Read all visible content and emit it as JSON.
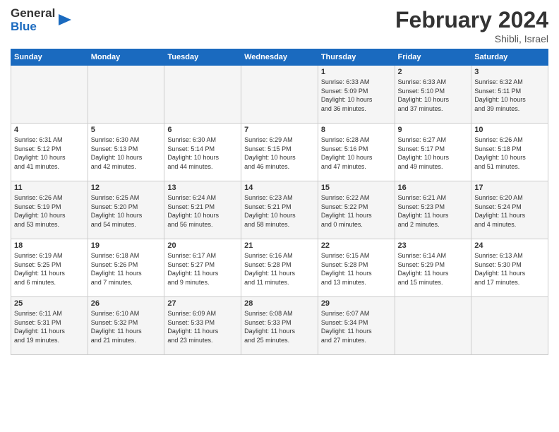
{
  "logo": {
    "general": "General",
    "blue": "Blue"
  },
  "title": "February 2024",
  "location": "Shibli, Israel",
  "weekdays": [
    "Sunday",
    "Monday",
    "Tuesday",
    "Wednesday",
    "Thursday",
    "Friday",
    "Saturday"
  ],
  "weeks": [
    [
      {
        "day": "",
        "info": ""
      },
      {
        "day": "",
        "info": ""
      },
      {
        "day": "",
        "info": ""
      },
      {
        "day": "",
        "info": ""
      },
      {
        "day": "1",
        "info": "Sunrise: 6:33 AM\nSunset: 5:09 PM\nDaylight: 10 hours\nand 36 minutes."
      },
      {
        "day": "2",
        "info": "Sunrise: 6:33 AM\nSunset: 5:10 PM\nDaylight: 10 hours\nand 37 minutes."
      },
      {
        "day": "3",
        "info": "Sunrise: 6:32 AM\nSunset: 5:11 PM\nDaylight: 10 hours\nand 39 minutes."
      }
    ],
    [
      {
        "day": "4",
        "info": "Sunrise: 6:31 AM\nSunset: 5:12 PM\nDaylight: 10 hours\nand 41 minutes."
      },
      {
        "day": "5",
        "info": "Sunrise: 6:30 AM\nSunset: 5:13 PM\nDaylight: 10 hours\nand 42 minutes."
      },
      {
        "day": "6",
        "info": "Sunrise: 6:30 AM\nSunset: 5:14 PM\nDaylight: 10 hours\nand 44 minutes."
      },
      {
        "day": "7",
        "info": "Sunrise: 6:29 AM\nSunset: 5:15 PM\nDaylight: 10 hours\nand 46 minutes."
      },
      {
        "day": "8",
        "info": "Sunrise: 6:28 AM\nSunset: 5:16 PM\nDaylight: 10 hours\nand 47 minutes."
      },
      {
        "day": "9",
        "info": "Sunrise: 6:27 AM\nSunset: 5:17 PM\nDaylight: 10 hours\nand 49 minutes."
      },
      {
        "day": "10",
        "info": "Sunrise: 6:26 AM\nSunset: 5:18 PM\nDaylight: 10 hours\nand 51 minutes."
      }
    ],
    [
      {
        "day": "11",
        "info": "Sunrise: 6:26 AM\nSunset: 5:19 PM\nDaylight: 10 hours\nand 53 minutes."
      },
      {
        "day": "12",
        "info": "Sunrise: 6:25 AM\nSunset: 5:20 PM\nDaylight: 10 hours\nand 54 minutes."
      },
      {
        "day": "13",
        "info": "Sunrise: 6:24 AM\nSunset: 5:21 PM\nDaylight: 10 hours\nand 56 minutes."
      },
      {
        "day": "14",
        "info": "Sunrise: 6:23 AM\nSunset: 5:21 PM\nDaylight: 10 hours\nand 58 minutes."
      },
      {
        "day": "15",
        "info": "Sunrise: 6:22 AM\nSunset: 5:22 PM\nDaylight: 11 hours\nand 0 minutes."
      },
      {
        "day": "16",
        "info": "Sunrise: 6:21 AM\nSunset: 5:23 PM\nDaylight: 11 hours\nand 2 minutes."
      },
      {
        "day": "17",
        "info": "Sunrise: 6:20 AM\nSunset: 5:24 PM\nDaylight: 11 hours\nand 4 minutes."
      }
    ],
    [
      {
        "day": "18",
        "info": "Sunrise: 6:19 AM\nSunset: 5:25 PM\nDaylight: 11 hours\nand 6 minutes."
      },
      {
        "day": "19",
        "info": "Sunrise: 6:18 AM\nSunset: 5:26 PM\nDaylight: 11 hours\nand 7 minutes."
      },
      {
        "day": "20",
        "info": "Sunrise: 6:17 AM\nSunset: 5:27 PM\nDaylight: 11 hours\nand 9 minutes."
      },
      {
        "day": "21",
        "info": "Sunrise: 6:16 AM\nSunset: 5:28 PM\nDaylight: 11 hours\nand 11 minutes."
      },
      {
        "day": "22",
        "info": "Sunrise: 6:15 AM\nSunset: 5:28 PM\nDaylight: 11 hours\nand 13 minutes."
      },
      {
        "day": "23",
        "info": "Sunrise: 6:14 AM\nSunset: 5:29 PM\nDaylight: 11 hours\nand 15 minutes."
      },
      {
        "day": "24",
        "info": "Sunrise: 6:13 AM\nSunset: 5:30 PM\nDaylight: 11 hours\nand 17 minutes."
      }
    ],
    [
      {
        "day": "25",
        "info": "Sunrise: 6:11 AM\nSunset: 5:31 PM\nDaylight: 11 hours\nand 19 minutes."
      },
      {
        "day": "26",
        "info": "Sunrise: 6:10 AM\nSunset: 5:32 PM\nDaylight: 11 hours\nand 21 minutes."
      },
      {
        "day": "27",
        "info": "Sunrise: 6:09 AM\nSunset: 5:33 PM\nDaylight: 11 hours\nand 23 minutes."
      },
      {
        "day": "28",
        "info": "Sunrise: 6:08 AM\nSunset: 5:33 PM\nDaylight: 11 hours\nand 25 minutes."
      },
      {
        "day": "29",
        "info": "Sunrise: 6:07 AM\nSunset: 5:34 PM\nDaylight: 11 hours\nand 27 minutes."
      },
      {
        "day": "",
        "info": ""
      },
      {
        "day": "",
        "info": ""
      }
    ]
  ]
}
